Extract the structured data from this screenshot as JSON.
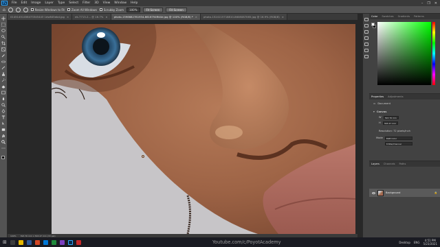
{
  "menu": {
    "logo": "Ps",
    "items": [
      "File",
      "Edit",
      "Image",
      "Layer",
      "Type",
      "Select",
      "Filter",
      "3D",
      "View",
      "Window",
      "Help"
    ],
    "controls": [
      "–",
      "❐",
      "✕"
    ]
  },
  "options": {
    "resize_windows_label": "Resize Windows to Fit",
    "zoom_all_windows_label": "Zoom All Windows",
    "scrubby_zoom_label": "Scrubby Zoom",
    "zoom_value": "100%",
    "fit_screen_label": "Fit Screen",
    "fill_screen_label": "Fill Screen"
  },
  "tabs": [
    {
      "label": "01451451456473345443 1dw645ebd.jpg",
      "active": false
    },
    {
      "label": "ek-7713-2... @ 16.7%",
      "active": false
    },
    {
      "label": "photo-1596682781934-6616794ffd4d.jpg @ 100% (RGB/8) *",
      "active": true
    },
    {
      "label": "photo-1524115718810-8608087065.jpg @ 16.9% (RGB/8)",
      "active": false
    }
  ],
  "status": {
    "zoom": "100%",
    "doc_size": "393.76 mm x 393.47 mm (72 ppi)"
  },
  "color_panel": {
    "tabs": [
      "Color",
      "Swatches",
      "Gradients",
      "Patterns"
    ],
    "active": "Color"
  },
  "properties": {
    "tabs": [
      "Properties",
      "Adjustments"
    ],
    "doc_label": "Document",
    "canvas_label": "Canvas",
    "w_label": "W",
    "w_value": "393.76 mm",
    "h_label": "H",
    "h_value": "393.47 mm",
    "resolution_label": "Resolution: 72 pixels/inch",
    "mode_label": "Mode",
    "mode_value": "RGB Color",
    "depth_value": "8 Bits/Channel"
  },
  "layers": {
    "tabs": [
      "Layers",
      "Channels",
      "Paths"
    ],
    "items": [
      {
        "name": "Background",
        "locked": true
      }
    ]
  },
  "taskbar": {
    "watermark": "Youtube.com/c/PoyotAcademy",
    "desktop_label": "Desktop",
    "lang": "ENG",
    "time": "4:51 PM",
    "date": "5/23/2021"
  },
  "colors": {
    "skin_base": "#a2694b",
    "lip": "#b06b5f",
    "background": "#c7c5c8",
    "iris": "#3a6f98"
  }
}
